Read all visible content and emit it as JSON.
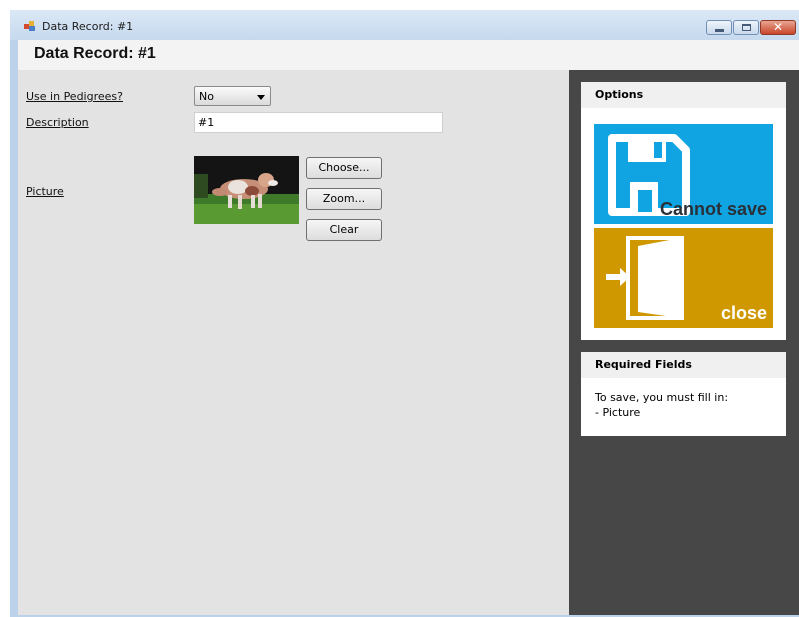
{
  "window": {
    "title": "Data Record: #1",
    "controls": {
      "minimize": "minimize",
      "maximize": "maximize",
      "close": "✕"
    }
  },
  "header": {
    "title": "Data Record: #1"
  },
  "form": {
    "pedigree": {
      "label": "Use in Pedigrees?",
      "value": "No"
    },
    "description": {
      "label": "Description",
      "value": "#1"
    },
    "picture": {
      "label": "Picture",
      "buttons": {
        "choose": "Choose...",
        "zoom": "Zoom...",
        "clear": "Clear"
      }
    }
  },
  "options": {
    "title": "Options",
    "save_tile": {
      "label": "Cannot save",
      "color": "#10a4e2",
      "icon": "floppy-disk-icon"
    },
    "close_tile": {
      "label": "close",
      "color": "#cf9700",
      "icon": "door-exit-icon"
    }
  },
  "required_fields": {
    "title": "Required Fields",
    "lines": [
      "To save, you must fill in:",
      "- Picture"
    ]
  }
}
